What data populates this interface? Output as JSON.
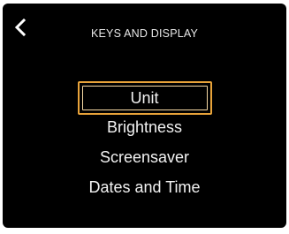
{
  "header": {
    "title": "KEYS AND DISPLAY",
    "back_icon": "chevron-left-icon"
  },
  "menu": {
    "selected_index": 0,
    "items": [
      {
        "label": "Unit"
      },
      {
        "label": "Brightness"
      },
      {
        "label": "Screensaver"
      },
      {
        "label": "Dates and Time"
      }
    ]
  },
  "colors": {
    "background": "#000000",
    "text": "#f2f2f2",
    "selection_border": "#e8a33a",
    "selection_inner": "#f6d9a4"
  }
}
